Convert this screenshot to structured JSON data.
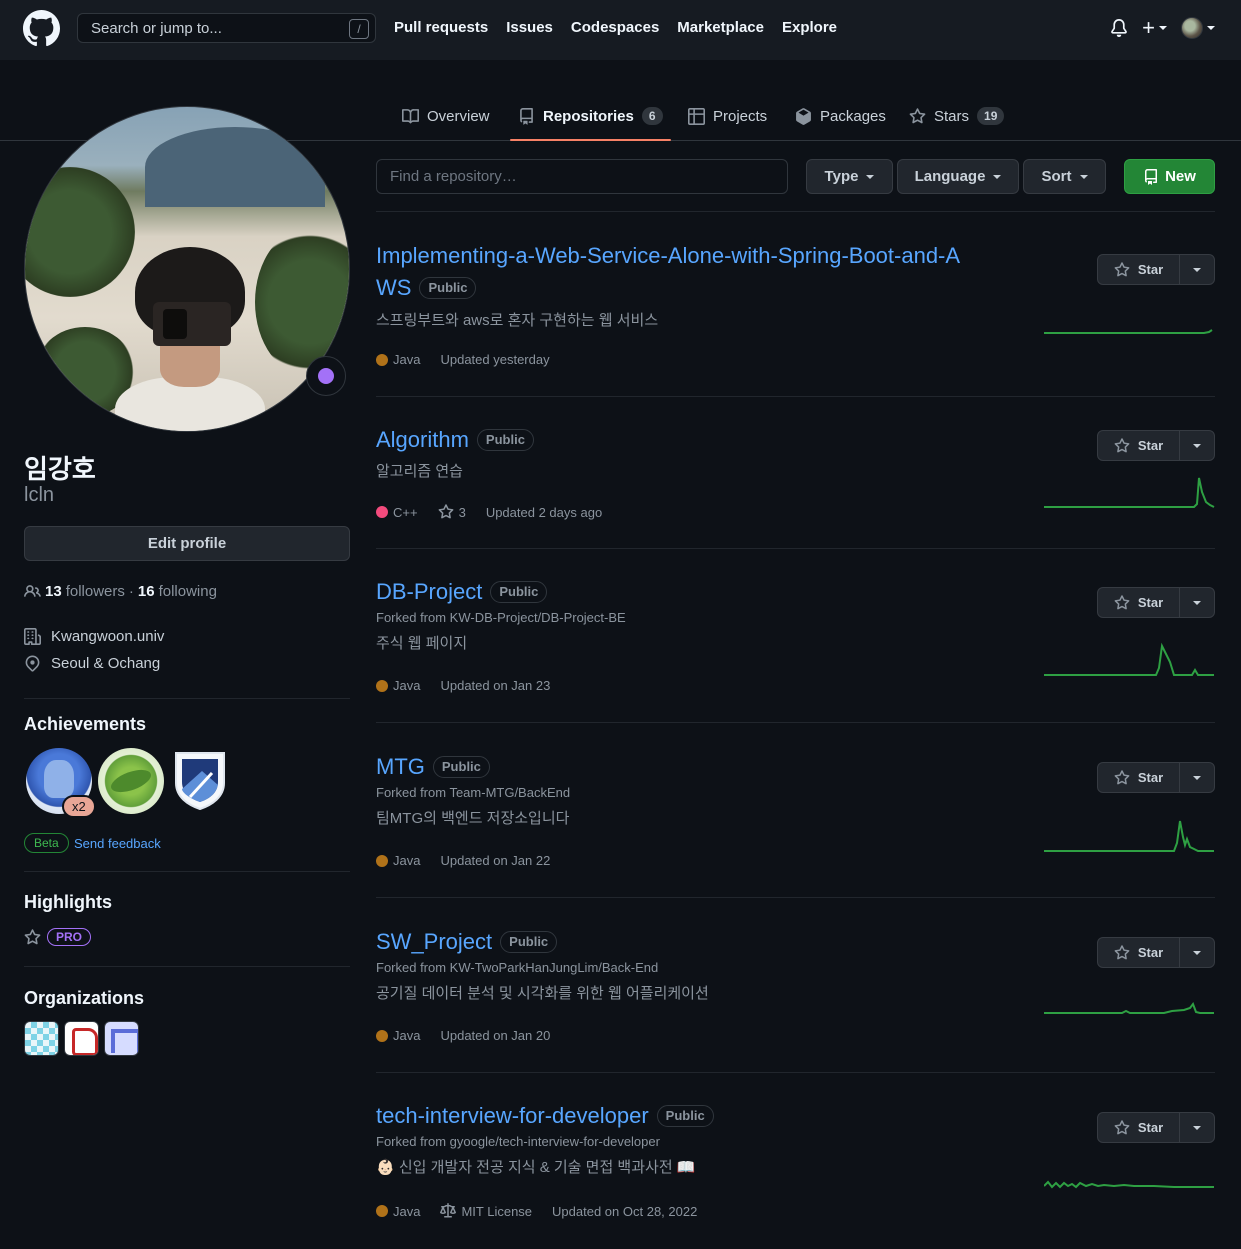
{
  "header": {
    "search_placeholder": "Search or jump to...",
    "search_shortcut": "/",
    "nav": [
      "Pull requests",
      "Issues",
      "Codespaces",
      "Marketplace",
      "Explore"
    ]
  },
  "tabs": {
    "overview": "Overview",
    "repositories": "Repositories",
    "repositories_count": "6",
    "projects": "Projects",
    "packages": "Packages",
    "stars": "Stars",
    "stars_count": "19"
  },
  "profile": {
    "fullname": "임강호",
    "username": "lcln",
    "edit_label": "Edit profile",
    "followers": "13",
    "followers_label": "followers",
    "sep": "·",
    "following": "16",
    "following_label": "following",
    "organization": "Kwangwoon.univ",
    "location": "Seoul & Ochang"
  },
  "achievements": {
    "heading": "Achievements",
    "multiplier": "x2",
    "beta": "Beta",
    "feedback": "Send feedback"
  },
  "highlights": {
    "heading": "Highlights",
    "pro": "PRO"
  },
  "organizations": {
    "heading": "Organizations"
  },
  "toolbar": {
    "find_placeholder": "Find a repository…",
    "type": "Type",
    "language": "Language",
    "sort": "Sort",
    "new": "New"
  },
  "star_label": "Star",
  "repos": [
    {
      "name": "Implementing-a-Web-Service-Alone-with-Spring-Boot-and-A",
      "name2": "WS",
      "visibility": "Public",
      "forked": "",
      "description": "스프링부트와 aws로 혼자 구현하는 웹 서비스",
      "language": "Java",
      "lang_color": "#b07219",
      "stars": "",
      "license": "",
      "updated": "Updated yesterday"
    },
    {
      "name": "Algorithm",
      "visibility": "Public",
      "forked": "",
      "description": "알고리즘 연습",
      "language": "C++",
      "lang_color": "#f34b7d",
      "stars": "3",
      "license": "",
      "updated": "Updated 2 days ago"
    },
    {
      "name": "DB-Project",
      "visibility": "Public",
      "forked": "Forked from KW-DB-Project/DB-Project-BE",
      "description": "주식 웹 페이지",
      "language": "Java",
      "lang_color": "#b07219",
      "stars": "",
      "license": "",
      "updated": "Updated on Jan 23"
    },
    {
      "name": "MTG",
      "visibility": "Public",
      "forked": "Forked from Team-MTG/BackEnd",
      "description": "팀MTG의 백엔드 저장소입니다",
      "language": "Java",
      "lang_color": "#b07219",
      "stars": "",
      "license": "",
      "updated": "Updated on Jan 22"
    },
    {
      "name": "SW_Project",
      "visibility": "Public",
      "forked": "Forked from KW-TwoParkHanJungLim/Back-End",
      "description": "공기질 데이터 분석 및 시각화를 위한 웹 어플리케이션",
      "language": "Java",
      "lang_color": "#b07219",
      "stars": "",
      "license": "",
      "updated": "Updated on Jan 20"
    },
    {
      "name": "tech-interview-for-developer",
      "visibility": "Public",
      "forked": "Forked from gyoogle/tech-interview-for-developer",
      "description": "👶🏻 신입 개발자 전공 지식 & 기술 면접 백과사전 📖",
      "language": "Java",
      "lang_color": "#b07219",
      "stars": "",
      "license": "MIT License",
      "updated": "Updated on Oct 28, 2022"
    }
  ],
  "colors": {
    "accent": "#58a6ff",
    "new_button": "#238636",
    "active_tab": "#f78166",
    "spark": "#2ea043"
  }
}
